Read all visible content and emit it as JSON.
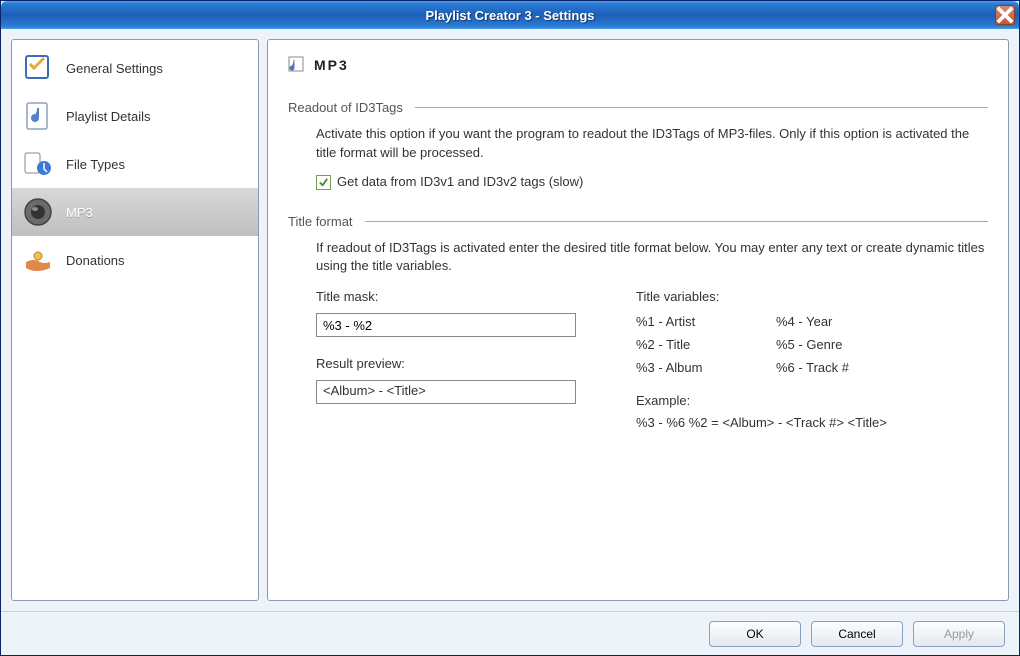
{
  "window": {
    "title": "Playlist Creator 3 - Settings"
  },
  "sidebar": {
    "items": [
      {
        "label": "General Settings"
      },
      {
        "label": "Playlist Details"
      },
      {
        "label": "File Types"
      },
      {
        "label": "MP3"
      },
      {
        "label": "Donations"
      }
    ],
    "active_index": 3
  },
  "panel": {
    "header": "MP3",
    "section1": {
      "title": "Readout of ID3Tags",
      "desc": "Activate this option if you want the program to readout the ID3Tags of MP3-files. Only if this option is activated the title format will be processed.",
      "checkbox_label": "Get data from ID3v1 and ID3v2 tags (slow)",
      "checkbox_checked": true
    },
    "section2": {
      "title": "Title format",
      "desc": "If readout of ID3Tags is activated enter the desired title format below. You may enter any text or create dynamic titles using the title variables.",
      "title_mask_label": "Title mask:",
      "title_mask_value": "%3 - %2",
      "result_preview_label": "Result preview:",
      "result_preview_value": "<Album> - <Title>",
      "vars_label": "Title variables:",
      "vars": {
        "v1": "%1 - Artist",
        "v2": "%2 - Title",
        "v3": "%3 - Album",
        "v4": "%4 - Year",
        "v5": "%5 - Genre",
        "v6": "%6 - Track #"
      },
      "example_label": "Example:",
      "example_text": "%3 - %6 %2  =  <Album> - <Track #> <Title>"
    }
  },
  "buttons": {
    "ok": "OK",
    "cancel": "Cancel",
    "apply": "Apply"
  }
}
